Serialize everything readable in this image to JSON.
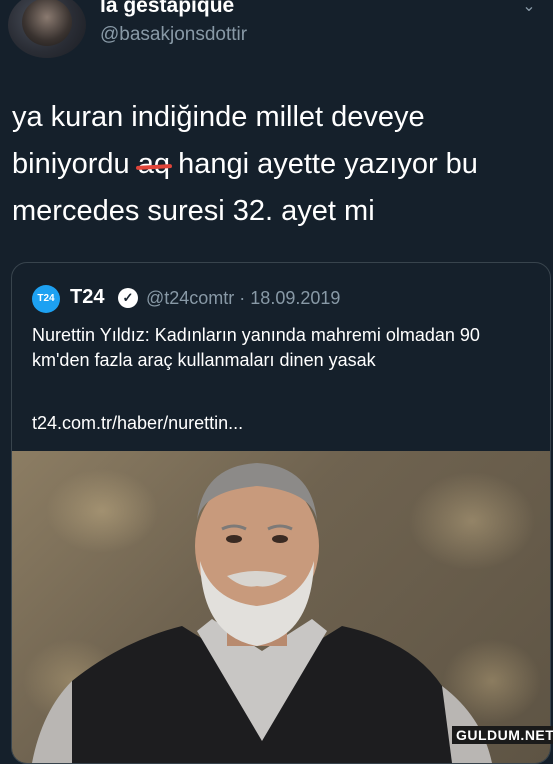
{
  "header": {
    "display_name": "la géstapique",
    "handle": "@basakjonsdottir"
  },
  "tweet": {
    "text_before": "ya kuran indiğinde millet deveye biniyordu ",
    "scribbled": "aq",
    "text_after": " hangi ayette yazıyor bu mercedes suresi 32. ayet mi"
  },
  "quoted": {
    "logo": "T24",
    "name": "T24",
    "handle_date": "@t24comtr · 18.09.2019",
    "body": "Nurettin Yıldız: Kadınların yanında mahremi olmadan 90 km'den fazla araç kullanmaları dinen yasak",
    "link": "t24.com.tr/haber/nurettin..."
  },
  "watermark": "GULDUM.NET",
  "colors": {
    "background": "#15202b",
    "secondary_text": "#8899a6",
    "verified_badge": "#ffffff",
    "scribble": "#e0453a"
  }
}
